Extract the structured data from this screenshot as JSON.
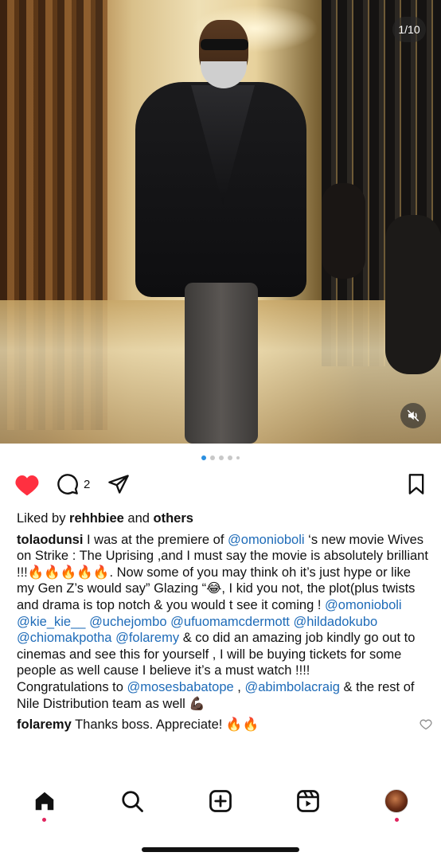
{
  "post": {
    "counter": "1/10",
    "comment_count": "2",
    "liked_by_prefix": "Liked by ",
    "liked_by_user": "rehhbiee",
    "liked_by_and": " and ",
    "liked_by_others": "others"
  },
  "carousel": {
    "total_dots": 5,
    "active_index": 0
  },
  "caption": {
    "username": "tolaodunsi",
    "seg1": " I was at the premiere of ",
    "m1": "@omonioboli",
    "seg2": " ‘s new movie Wives on Strike : The Uprising ,and I must say the movie is absolutely brilliant !!!🔥🔥🔥🔥🔥. Now some of you may think oh it’s just hype or like my Gen Z’s would say” Glazing “😂, I kid you not, the plot(plus  twists and drama is top notch & you would t see it coming ! ",
    "m2": "@omonioboli",
    "m3": "@kie_kie__",
    "m4": "@uchejombo",
    "m5": "@ufuomamcdermott",
    "m6": "@hildadokubo",
    "m7": "@chiomakpotha",
    "m8": "@folaremy",
    "seg3": " & co did an amazing job kindly go out to cinemas and see this for yourself , I will be buying tickets for some people as well cause I believe it’s a must watch !!!!",
    "p2_seg1": "Congratulations to ",
    "p2_m1": "@mosesbabatope",
    "p2_seg2": " , ",
    "p2_m2": "@abimbolacraig",
    "p2_seg3": " & the rest of  Nile Distribution team as well 💪🏿"
  },
  "comment": {
    "username": "folaremy",
    "text": " Thanks boss. Appreciate! 🔥🔥"
  },
  "nav": {
    "items": [
      "home-icon",
      "search-icon",
      "create-icon",
      "reels-icon",
      "profile-avatar"
    ]
  },
  "colors": {
    "like_red": "#ff3040",
    "mention_blue": "#1e6bb8",
    "active_dot": "#2b8fe0",
    "notification_dot": "#e0245e"
  }
}
